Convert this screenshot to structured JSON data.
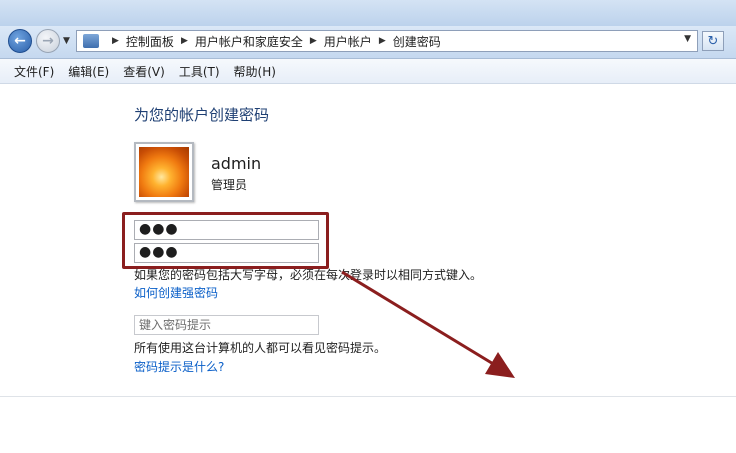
{
  "breadcrumb": [
    "控制面板",
    "用户帐户和家庭安全",
    "用户帐户",
    "创建密码"
  ],
  "menu": [
    "文件(F)",
    "编辑(E)",
    "查看(V)",
    "工具(T)",
    "帮助(H)"
  ],
  "page": {
    "heading": "为您的帐户创建密码",
    "user_name": "admin",
    "user_role": "管理员",
    "password": "●●●",
    "confirm_password": "●●●",
    "case_note": "如果您的密码包括大写字母，必须在每次登录时以相同方式键入。",
    "strong_link": "如何创建强密码",
    "hint_placeholder": "键入密码提示",
    "hint_note": "所有使用这台计算机的人都可以看见密码提示。",
    "hint_link": "密码提示是什么?"
  },
  "colors": {
    "highlight": "#8b1e1e",
    "link": "#0a5fc8",
    "heading": "#1e3f73"
  },
  "icons": [
    "back-arrow-icon",
    "forward-arrow-icon",
    "control-panel-icon",
    "refresh-icon",
    "user-avatar-flower"
  ]
}
